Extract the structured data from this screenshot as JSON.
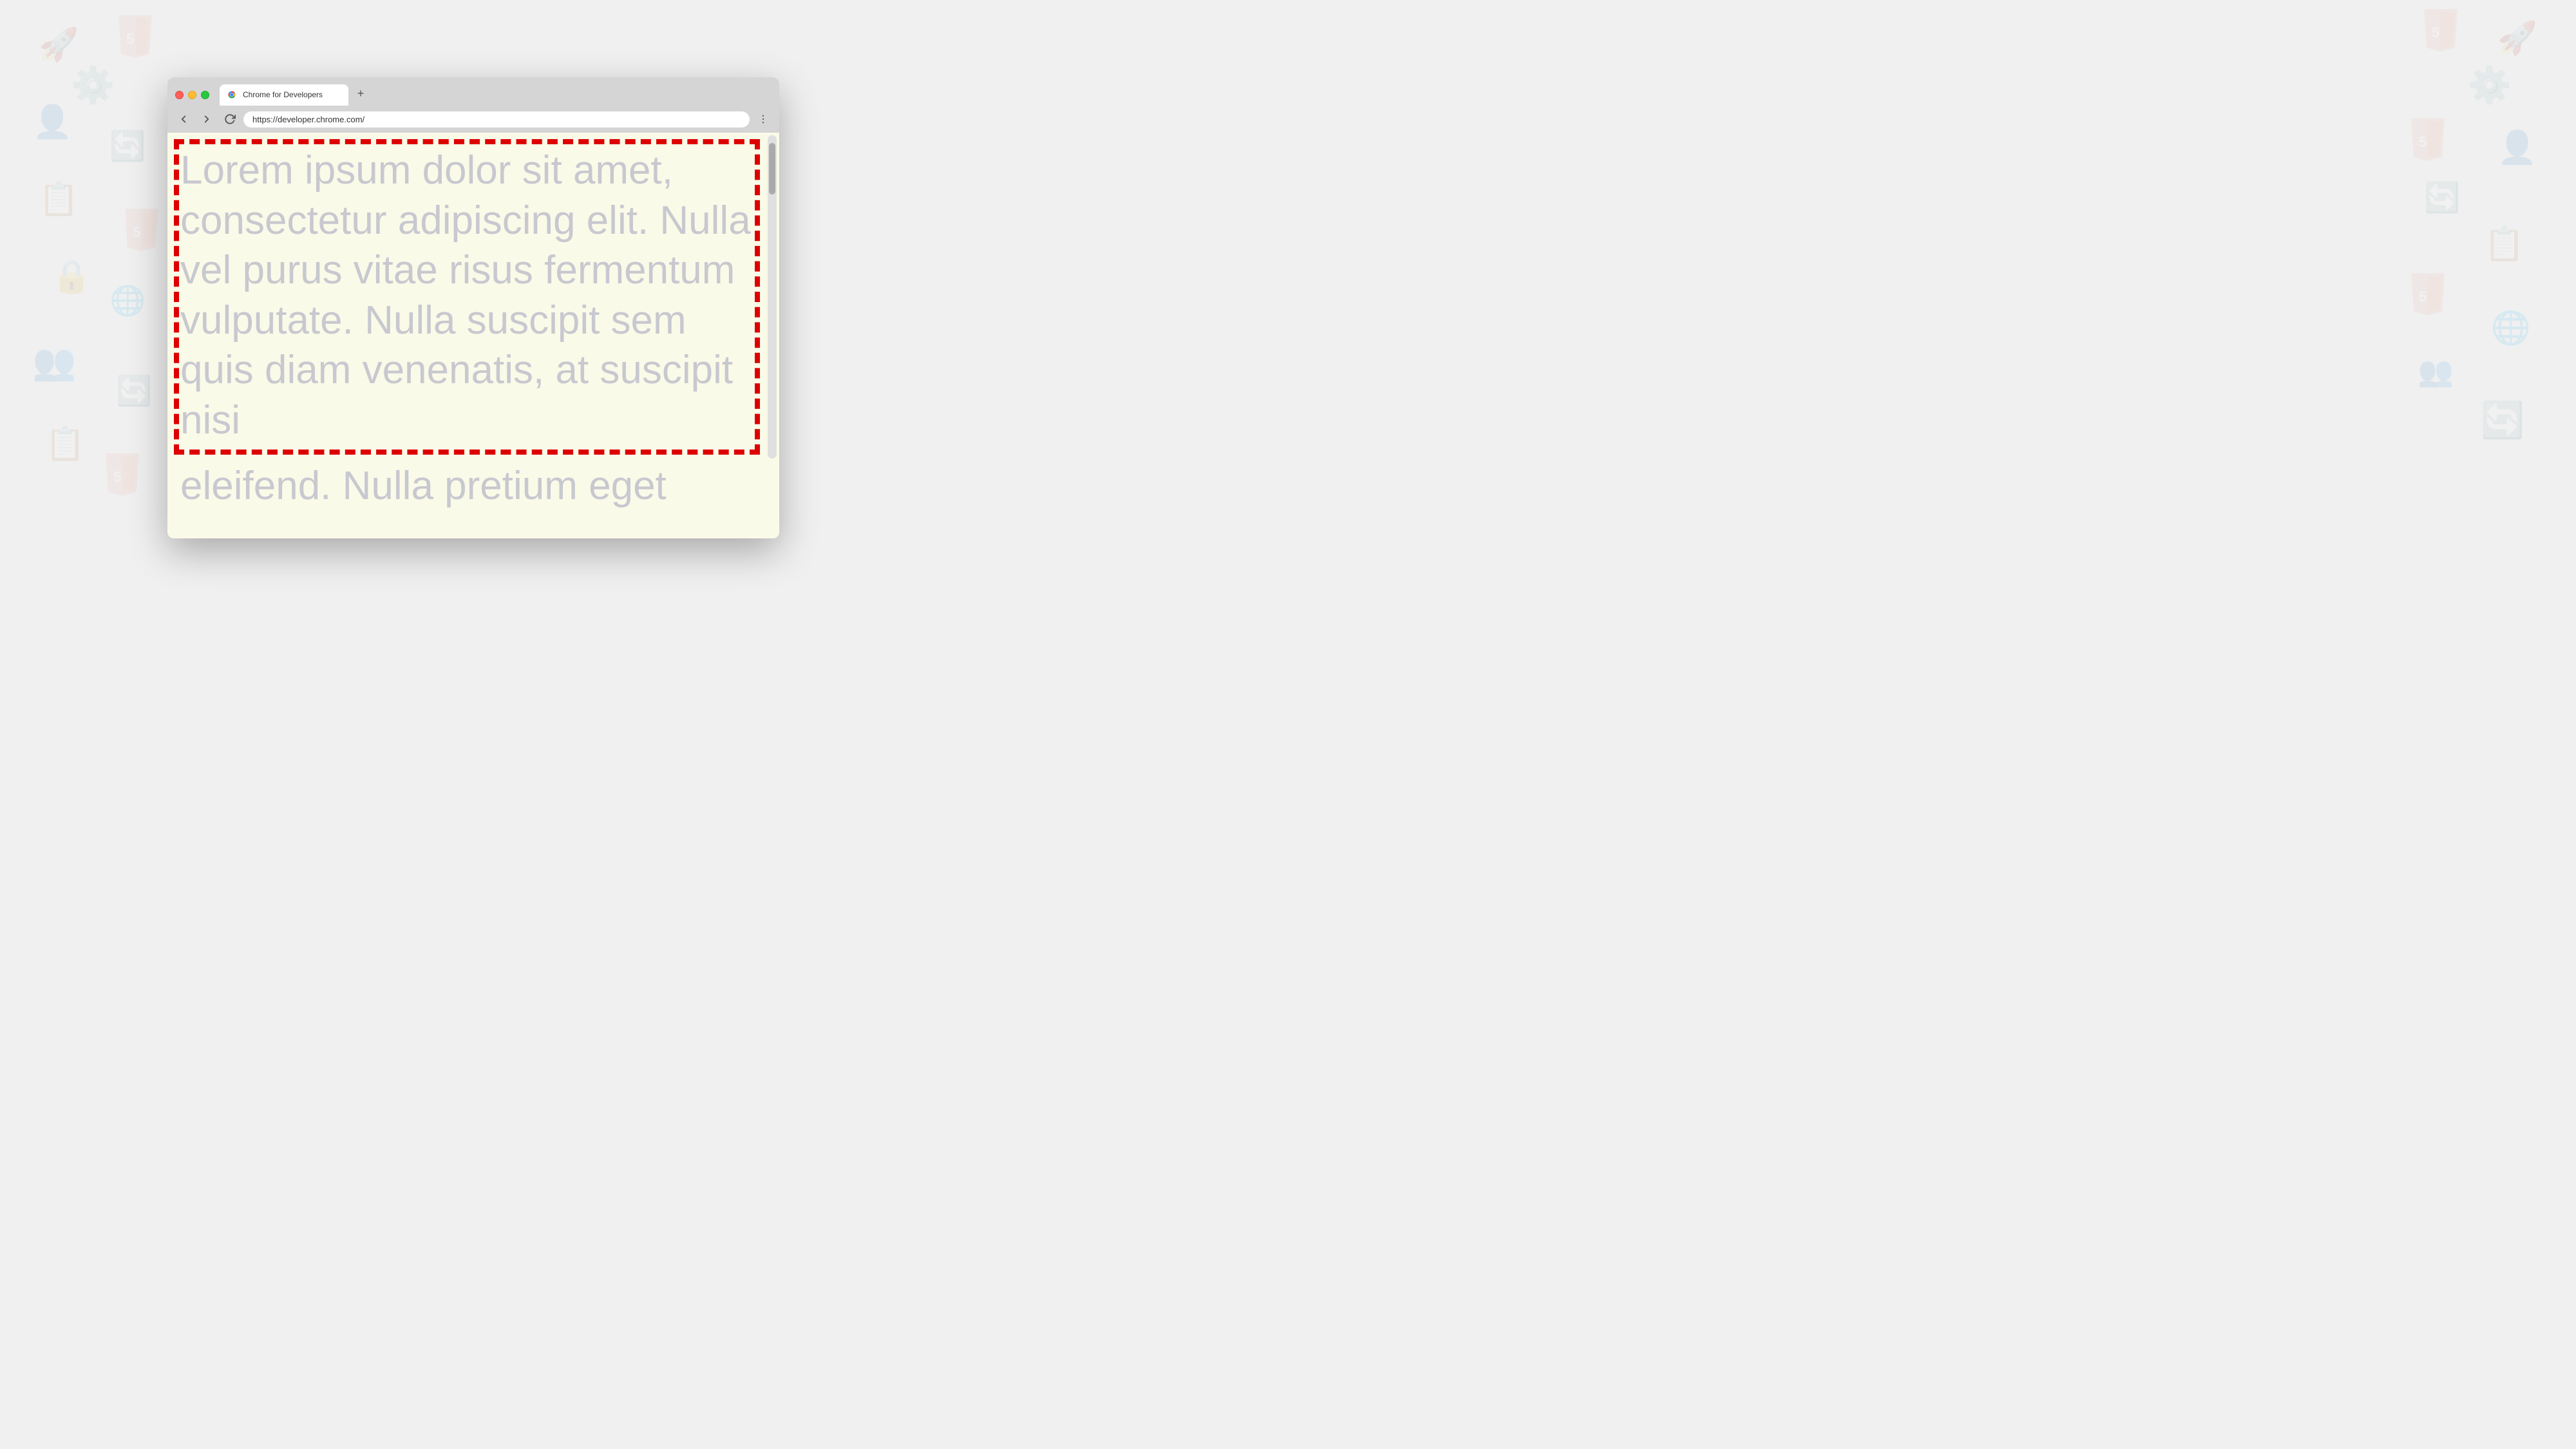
{
  "background": {
    "color": "#f0f0f0"
  },
  "browser": {
    "tab": {
      "title": "Chrome for Developers",
      "favicon": "chrome-logo"
    },
    "new_tab_label": "+",
    "address": "https://developer.chrome.com/",
    "nav": {
      "back_icon": "arrow-left",
      "forward_icon": "arrow-right",
      "reload_icon": "reload",
      "menu_icon": "three-dots"
    }
  },
  "page": {
    "background_color": "#fafae8",
    "text_color": "#c8c8d0",
    "border_color": "#dd0000",
    "lorem_text": "Lorem ipsum dolor sit amet, consectetur adipiscing elit. Nulla vel purus vitae risus fermentum vulputate. Nulla suscipit sem quis diam venenatis, at suscipit nisi eleifend. Nulla pretium eget"
  }
}
